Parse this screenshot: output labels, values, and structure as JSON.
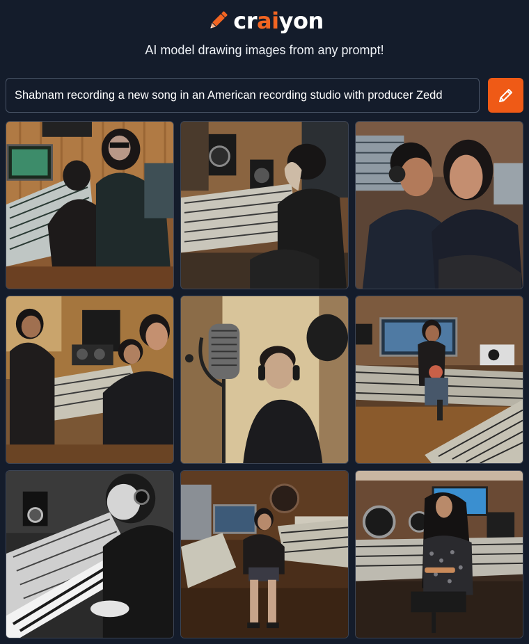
{
  "brand": {
    "prefix": "cr",
    "accent": "ai",
    "suffix": "yon",
    "accent_color": "#f26522"
  },
  "tagline": "AI model drawing images from any prompt!",
  "prompt": {
    "value": "Shabnam recording a new song in an American recording studio with producer Zedd"
  },
  "draw_button": {
    "icon": "pencil-icon",
    "color": "#ef5a16"
  },
  "images": [
    {
      "name": "generated-image-1"
    },
    {
      "name": "generated-image-2"
    },
    {
      "name": "generated-image-3"
    },
    {
      "name": "generated-image-4"
    },
    {
      "name": "generated-image-5"
    },
    {
      "name": "generated-image-6"
    },
    {
      "name": "generated-image-7"
    },
    {
      "name": "generated-image-8"
    },
    {
      "name": "generated-image-9"
    }
  ]
}
